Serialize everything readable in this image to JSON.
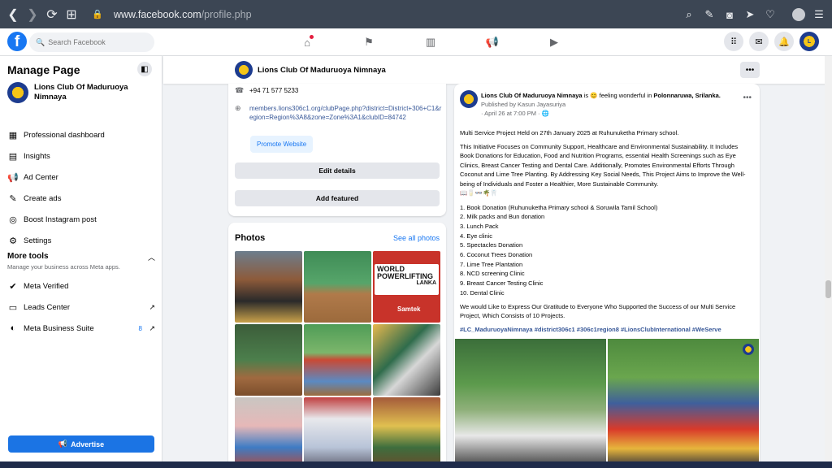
{
  "browser": {
    "url_domain": "www.facebook.com",
    "url_path": "/profile.php"
  },
  "topnav": {
    "search_placeholder": "Search Facebook"
  },
  "sidebar": {
    "title": "Manage Page",
    "page_name": "Lions Club Of Maduruoya Nimnaya",
    "items": [
      {
        "label": "Professional dashboard",
        "icon": "dashboard-icon"
      },
      {
        "label": "Insights",
        "icon": "insights-icon"
      },
      {
        "label": "Ad Center",
        "icon": "megaphone-icon"
      },
      {
        "label": "Create ads",
        "icon": "edit-icon"
      },
      {
        "label": "Boost Instagram post",
        "icon": "instagram-icon"
      },
      {
        "label": "Settings",
        "icon": "gear-icon"
      }
    ],
    "more_tools_title": "More tools",
    "more_tools_subtitle": "Manage your business across Meta apps.",
    "tools": [
      {
        "label": "Meta Verified",
        "icon": "verified-icon"
      },
      {
        "label": "Leads Center",
        "icon": "leads-icon"
      },
      {
        "label": "Meta Business Suite",
        "icon": "business-suite-icon",
        "badge": "8"
      }
    ],
    "advertise_label": "Advertise"
  },
  "page_header": {
    "title": "Lions Club Of Maduruoya Nimnaya",
    "more_label": "•••"
  },
  "intro": {
    "phone": "+94 71 577 5233",
    "website": "members.lions306c1.org/clubPage.php?district=District+306+C1&region=Region%3A8&zone=Zone%3A1&clubID=84742",
    "promote_label": "Promote Website",
    "edit_details_label": "Edit details",
    "add_featured_label": "Add featured"
  },
  "photos": {
    "title": "Photos",
    "see_all": "See all photos",
    "banner_title": "WORLD POWERLIFTING",
    "banner_sub": "LANKA",
    "banner_brand": "Samtek"
  },
  "post": {
    "author": "Lions Club Of Maduruoya Nimnaya",
    "feeling": "is 😊 feeling wonderful in",
    "location": "Polonnaruwa, Srilanka.",
    "published_by": "Published by Kasun Jayasuriya",
    "date": "· April 26 at 7:00 PM · 🌐",
    "line1": "Multi Service Project Held on 27th January 2025 at Ruhunuketha Primary school.",
    "para1": "This Initiative Focuses on Community Support, Healthcare and Environmental Sustainability. It Includes Book Donations for Education, Food and Nutrition Programs, essential Health Screenings such as Eye Clinics, Breast Cancer Testing and Dental Care. Additionally, Promotes Environmental Efforts Through Coconut and Lime Tree Planting. By Addressing Key Social Needs, This Project Aims to Improve the Well-being of Individuals and Foster a Healthier, More Sustainable Community.",
    "emoji_line": "📖🥛👓🌴🦷",
    "list": [
      "1. Book Donation (Ruhunuketha Primary school & Soruwila Tamil School)",
      "2. Milk packs and Bun donation",
      "3. Lunch Pack",
      "4. Eye clinic",
      "5. Spectacles Donation",
      "6. Coconut Trees Donation",
      "7. Lime Tree Plantation",
      "8. NCD screening Clinic",
      "9. Breast Cancer Testing Clinic",
      "10. Dental Clinic"
    ],
    "thanks": "We would Like to Express Our Gratitude to Everyone Who Supported the Success of our Multi Service Project, Which Consists of 10 Projects.",
    "hashtags": "#LC_MaduruoyaNimnaya #district306c1 #306c1region8 #LionsClubInternational #WeServe"
  }
}
